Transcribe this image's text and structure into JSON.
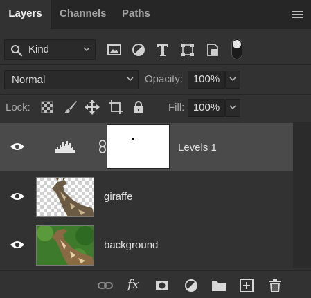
{
  "tabs": [
    {
      "label": "Layers",
      "active": true
    },
    {
      "label": "Channels",
      "active": false
    },
    {
      "label": "Paths",
      "active": false
    }
  ],
  "filter": {
    "kind_label": "Kind",
    "icons": [
      "pixel-layer-filter-icon",
      "adjustment-layer-filter-icon",
      "type-layer-filter-icon",
      "shape-layer-filter-icon",
      "smart-object-filter-icon"
    ]
  },
  "blend": {
    "mode": "Normal",
    "opacity_label": "Opacity:",
    "opacity_value": "100%"
  },
  "lock": {
    "label": "Lock:",
    "icons": [
      "lock-transparent-pixels-icon",
      "lock-image-pixels-icon",
      "lock-position-icon",
      "lock-artboard-icon",
      "lock-all-icon"
    ],
    "fill_label": "Fill:",
    "fill_value": "100%"
  },
  "layers": [
    {
      "name": "Levels 1",
      "type": "adjustment",
      "visible": true,
      "selected": true
    },
    {
      "name": "giraffe",
      "type": "pixel",
      "visible": true,
      "selected": false
    },
    {
      "name": "background",
      "type": "pixel",
      "visible": true,
      "selected": false
    }
  ],
  "bottom_icons": [
    "link-layers-icon",
    "fx-icon",
    "add-mask-icon",
    "new-fill-adjustment-icon",
    "new-group-icon",
    "new-layer-icon",
    "delete-layer-icon"
  ],
  "bottom_fx_label": "fx",
  "colors": {
    "panel": "#323232",
    "tabbar": "#262626",
    "selected_row": "#4a4a4a",
    "text": "#d6d6d6"
  }
}
